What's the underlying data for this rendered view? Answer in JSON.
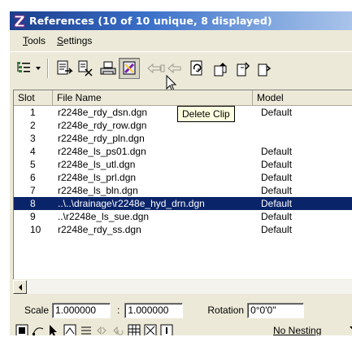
{
  "window": {
    "title": "References (10 of 10 unique, 8 displayed)",
    "title_colors": {
      "start": "#1a3e8c",
      "end": "#a9c3ea"
    }
  },
  "menu": {
    "items": [
      {
        "label": "Tools",
        "accel": "T",
        "rest": "ools"
      },
      {
        "label": "Settings",
        "accel": "S",
        "rest": "ettings"
      }
    ]
  },
  "toolbar": {
    "buttons": [
      {
        "name": "list-view",
        "icon": "list-tree-icon"
      },
      {
        "name": "attach",
        "icon": "attach-reference-icon"
      },
      {
        "name": "detach",
        "icon": "detach-reference-icon"
      },
      {
        "name": "print",
        "icon": "printer-icon"
      },
      {
        "name": "delete-clip",
        "icon": "delete-clip-icon",
        "state": "hovered"
      },
      {
        "name": "move",
        "icon": "move-icon",
        "state": "disabled"
      },
      {
        "name": "copy",
        "icon": "copy-icon",
        "state": "disabled"
      },
      {
        "name": "reload",
        "icon": "reload-icon"
      },
      {
        "name": "bring-forward",
        "icon": "bring-forward-icon"
      },
      {
        "name": "send-backward",
        "icon": "send-backward-icon"
      },
      {
        "name": "more",
        "icon": "more-icon"
      }
    ],
    "tooltip": "Delete Clip"
  },
  "list": {
    "columns": [
      "Slot",
      "File Name",
      "Model"
    ],
    "rows": [
      {
        "slot": "1",
        "file": "r2248e_rdy_dsn.dgn",
        "model": "Default",
        "selected": false
      },
      {
        "slot": "2",
        "file": "r2248e_rdy_row.dgn",
        "model": "",
        "selected": false
      },
      {
        "slot": "3",
        "file": "r2248e_rdy_pln.dgn",
        "model": "",
        "selected": false
      },
      {
        "slot": "4",
        "file": "r2248e_ls_ps01.dgn",
        "model": "Default",
        "selected": false
      },
      {
        "slot": "5",
        "file": "r2248e_ls_utl.dgn",
        "model": "Default",
        "selected": false
      },
      {
        "slot": "6",
        "file": "r2248e_ls_prl.dgn",
        "model": "Default",
        "selected": false
      },
      {
        "slot": "7",
        "file": "r2248e_ls_bln.dgn",
        "model": "Default",
        "selected": false
      },
      {
        "slot": "8",
        "file": "..\\..\\drainage\\r2248e_hyd_drn.dgn",
        "model": "Default",
        "selected": true
      },
      {
        "slot": "9",
        "file": "..\\r2248e_ls_sue.dgn",
        "model": "Default",
        "selected": false
      },
      {
        "slot": "10",
        "file": "r2248e_rdy_ss.dgn",
        "model": "Default",
        "selected": false
      }
    ],
    "selection_color": "#0a246a"
  },
  "scale": {
    "label": "Scale",
    "value1": "1.000000",
    "separator": ":",
    "value2": "1.000000",
    "rotation_label": "Rotation",
    "rotation_value": "0°0'0\""
  },
  "bottom_toolbar": {
    "nesting_value": "No Nesting"
  }
}
